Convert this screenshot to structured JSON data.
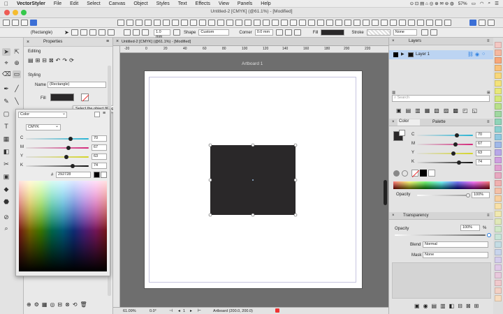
{
  "menubar": {
    "items": [
      "VectorStyler",
      "File",
      "Edit",
      "Select",
      "Canvas",
      "Object",
      "Styles",
      "Text",
      "Effects",
      "View",
      "Panels",
      "Help"
    ],
    "battery": "57%"
  },
  "window": {
    "title": "Untitled-2 [CMYK] (@61.1%) - [Modified]"
  },
  "controlbar": {
    "object_type": "(Rectangle)",
    "stroke_width": "1.0 mm",
    "shape_label": "Shape",
    "shape_value": "Custom",
    "corner_label": "Corner",
    "corner_value": "0.0 mm",
    "fill_label": "Fill",
    "stroke_label": "Stroke",
    "stroke_value": "None"
  },
  "properties": {
    "tab": "Properties",
    "editing_label": "Editing",
    "styling_label": "Styling",
    "name_label": "Name",
    "name_value": "(Rectangle)",
    "fill_label": "Fill",
    "tooltip": "Select the object filling style"
  },
  "colorpop": {
    "dropdown": "Color",
    "mode": "CMYK",
    "channels": [
      {
        "label": "C",
        "value": "70",
        "color": "#28b4d4"
      },
      {
        "label": "M",
        "value": "67",
        "color": "#d4287a"
      },
      {
        "label": "Y",
        "value": "63",
        "color": "#d4d428"
      },
      {
        "label": "K",
        "value": "74",
        "color": "#333333"
      }
    ],
    "hash": "#",
    "hex": "292728"
  },
  "document": {
    "tab": "Untitled-2 [CMYK] (@61.1%) - [Modified]",
    "artboard": "Artboard 1",
    "fill_color": "#2a2829"
  },
  "rulers": {
    "h": [
      "-20",
      "0",
      "20",
      "40",
      "60",
      "80",
      "100",
      "120",
      "140",
      "160",
      "180",
      "200",
      "220"
    ]
  },
  "status": {
    "zoom": "61.09%",
    "angle": "0.0°",
    "page": "1",
    "artboard": "Artboard (200.0, 200.0)"
  },
  "layers": {
    "title": "Layers",
    "layer1": "Layer 1",
    "accent": "#2a7ee0"
  },
  "search": {
    "placeholder": "Search"
  },
  "colorpanel": {
    "tab1": "Color",
    "tab2": "Palette",
    "channels": [
      {
        "label": "C",
        "value": "70",
        "color": "#28b4d4"
      },
      {
        "label": "M",
        "value": "67",
        "color": "#d4287a"
      },
      {
        "label": "Y",
        "value": "63",
        "color": "#d4d428"
      },
      {
        "label": "K",
        "value": "74",
        "color": "#333333"
      }
    ],
    "opacity_label": "Opacity",
    "opacity_value": "100%"
  },
  "transparency": {
    "title": "Transparency",
    "opacity_label": "Opacity",
    "opacity_value": "100%",
    "pct": "%",
    "blend_label": "Blend",
    "blend_value": "Normal",
    "mask_label": "Mask",
    "mask_value": "None"
  },
  "swatch_colors": [
    "#f4c7c3",
    "#f6b8a0",
    "#f8a77a",
    "#f9c27a",
    "#f8d77a",
    "#f4e27a",
    "#e8e87a",
    "#d4e87a",
    "#b8e08a",
    "#a0d8a0",
    "#90d4b8",
    "#8cd0d0",
    "#90c8e0",
    "#a0b8e8",
    "#b8a8e8",
    "#d0a0e0",
    "#e0a0d0",
    "#e8a8c0",
    "#f0b0b0",
    "#f4c0a8",
    "#f8d0a0",
    "#f8e0a8",
    "#f0e8b0",
    "#e0e8b8",
    "#d0e8c8",
    "#c8e4d8",
    "#c4dce4",
    "#c8d4ec",
    "#d4ccec",
    "#e0c8e8",
    "#e8c8dc",
    "#f0c8cc",
    "#f4d0c4",
    "#f8dcc0"
  ]
}
